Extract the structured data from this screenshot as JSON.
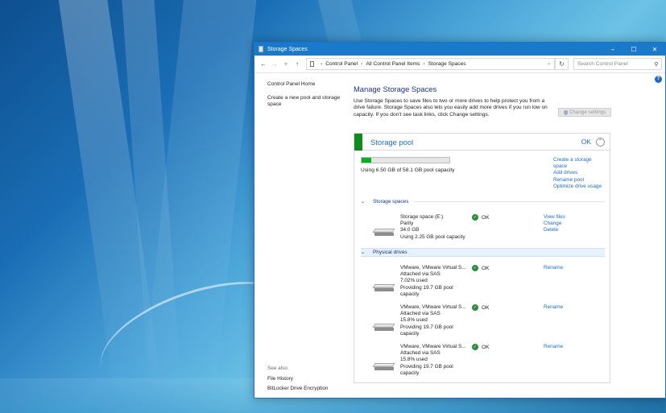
{
  "window": {
    "title": "Storage Spaces",
    "controls": {
      "minimize": "–",
      "maximize": "☐",
      "close": "✕"
    }
  },
  "address": {
    "breadcrumbs": [
      "Control Panel",
      "All Control Panel Items",
      "Storage Spaces"
    ],
    "search_placeholder": "Search Control Panel"
  },
  "left_nav": {
    "home": "Control Panel Home",
    "create_pool": "Create a new pool and storage space"
  },
  "see_also": {
    "header": "See also",
    "links": [
      "File History",
      "BitLocker Drive Encryption"
    ]
  },
  "main": {
    "heading": "Manage Storage Spaces",
    "description": "Use Storage Spaces to save files to two or more drives to help protect you from a drive failure. Storage Spaces also lets you easily add more drives if you run low on capacity. If you don't see task links, click Change settings.",
    "change_settings": "Change settings"
  },
  "pool": {
    "name": "Storage pool",
    "status": "OK",
    "usage_fraction": 0.112,
    "usage_text": "Using 6.50 GB of 58.1 GB pool capacity",
    "tasks": [
      "Create a storage space",
      "Add drives",
      "Rename pool",
      "Optimize drive usage"
    ],
    "accent_color": "#0e8a1e"
  },
  "storage_spaces": {
    "section_label": "Storage spaces",
    "items": [
      {
        "name": "Storage space (E:)",
        "lines": [
          "Parity",
          "34.0 GB",
          "Using 2.25 GB pool capacity"
        ],
        "status": "OK",
        "actions": [
          "View files",
          "Change",
          "Delete"
        ]
      }
    ]
  },
  "physical_drives": {
    "section_label": "Physical drives",
    "items": [
      {
        "name": "VMware, VMware Virtual S...",
        "lines": [
          "Attached via SAS",
          "7.02% used",
          "Providing 19.7 GB pool capacity"
        ],
        "status": "OK",
        "action": "Rename"
      },
      {
        "name": "VMware, VMware Virtual S...",
        "lines": [
          "Attached via SAS",
          "15.8% used",
          "Providing 19.7 GB pool capacity"
        ],
        "status": "OK",
        "action": "Rename"
      },
      {
        "name": "VMware, VMware Virtual S...",
        "lines": [
          "Attached via SAS",
          "15.8% used",
          "Providing 19.7 GB pool capacity"
        ],
        "status": "OK",
        "action": "Rename"
      }
    ]
  }
}
